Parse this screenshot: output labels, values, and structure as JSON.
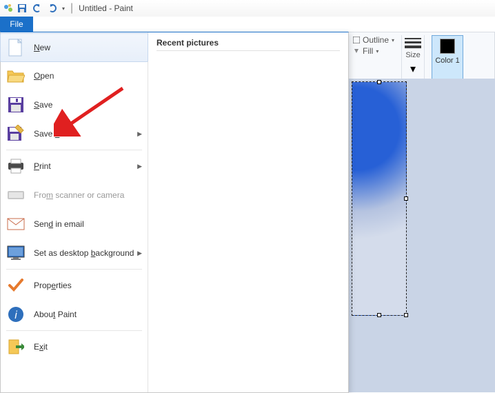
{
  "titlebar": {
    "title": "Untitled - Paint"
  },
  "tabs": {
    "file": "File"
  },
  "menu": {
    "new": "New",
    "open": "Open",
    "save": "Save",
    "save_as": "Save as",
    "print": "Print",
    "scanner": "From scanner or camera",
    "email": "Send in email",
    "wallpaper": "Set as desktop background",
    "properties": "Properties",
    "about": "About Paint",
    "exit": "Exit"
  },
  "recent": {
    "title": "Recent pictures"
  },
  "ribbon": {
    "outline": "Outline",
    "fill": "Fill",
    "size": "Size",
    "color1": "Color 1"
  }
}
